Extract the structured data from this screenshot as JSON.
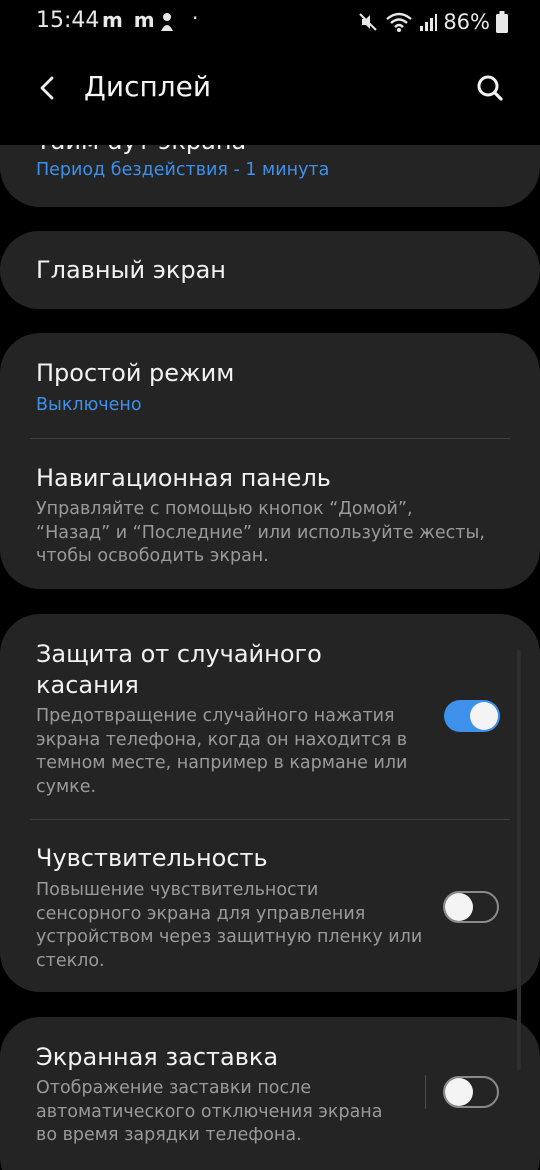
{
  "status_bar": {
    "time": "15:44",
    "notification_icons": "m m",
    "more": "·",
    "battery": "86%"
  },
  "header": {
    "title": "Дисплей",
    "back_icon": "back-arrow-icon",
    "search_icon": "search-icon"
  },
  "items": {
    "screen_timeout": {
      "title": "Тайм-аут экрана",
      "status": "Период бездействия - 1 минута"
    },
    "home_screen": {
      "title": "Главный экран"
    },
    "easy_mode": {
      "title": "Простой режим",
      "status": "Выключено"
    },
    "nav_bar": {
      "title": "Навигационная панель",
      "desc_lines": [
        "Управляйте с помощью кнопок “Домой”,",
        "“Назад” и “Последние” или используйте жесты,",
        "чтобы освободить экран."
      ]
    },
    "accidental_touch": {
      "title_lines": [
        "Защита от случайного",
        "касания"
      ],
      "desc_lines": [
        "Предотвращение случайного нажатия",
        "экрана телефона, когда он находится в",
        "темном месте, например в кармане или",
        "сумке."
      ],
      "enabled": true
    },
    "sensitivity": {
      "title": "Чувствительность",
      "desc_lines": [
        "Повышение чувствительности",
        "сенсорного экрана для управления",
        "устройством через защитную пленку или",
        "стекло."
      ],
      "enabled": false
    },
    "screensaver": {
      "title": "Экранная заставка",
      "desc_lines": [
        "Отображение заставки после",
        "автоматического отключения экрана",
        "во время зарядки телефона."
      ],
      "enabled": false
    }
  },
  "colors": {
    "background": "#000000",
    "card": "#242424",
    "accent": "#3e91ea",
    "secondary_text": "#9a9a9a"
  }
}
